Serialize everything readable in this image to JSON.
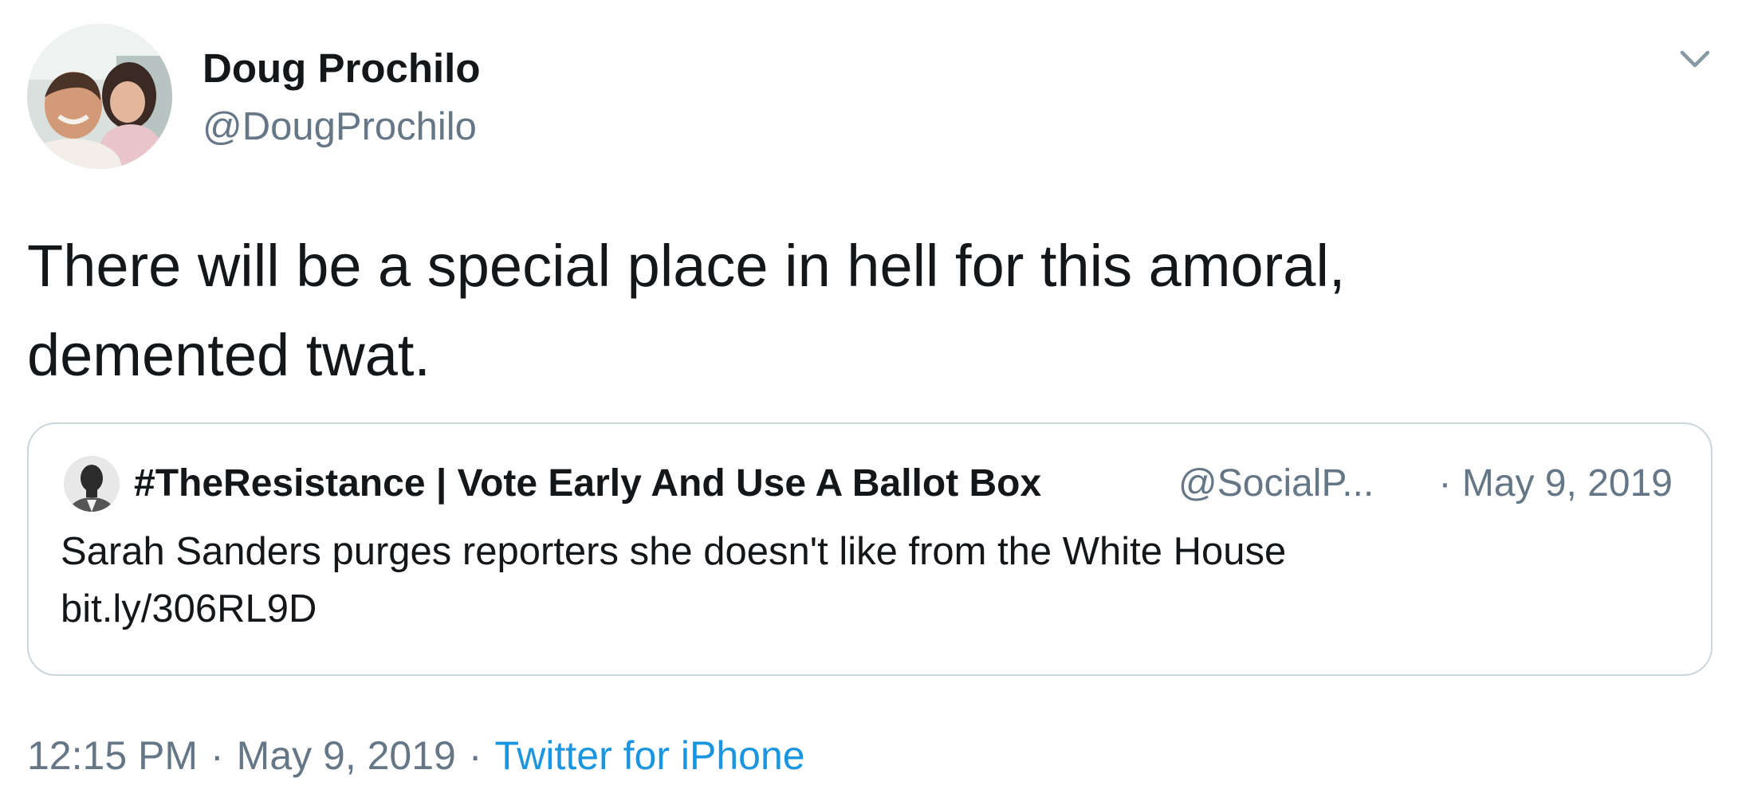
{
  "tweet": {
    "author": {
      "display_name": "Doug Prochilo",
      "handle": "@DougProchilo"
    },
    "text_lines": [
      "There will be a special place in hell for this amoral,",
      "demented twat."
    ],
    "quoted": {
      "display_name": "#TheResistance | Vote Early And Use A Ballot Box",
      "handle": "@SocialP...",
      "date": "· May 9, 2019",
      "text": "Sarah Sanders purges reporters she doesn't like from the White House",
      "link": "bit.ly/306RL9D"
    },
    "meta": {
      "time": "12:15 PM",
      "date": "May 9, 2019",
      "separator": "·",
      "source": "Twitter for iPhone"
    }
  },
  "icons": {
    "menu": "chevron-down-icon",
    "avatar": "profile-photo",
    "quote_avatar": "quoted-profile-photo"
  },
  "colors": {
    "text_primary": "#14171a",
    "text_secondary": "#657786",
    "link": "#1b95e0",
    "border": "#ccd6dd",
    "background": "#ffffff"
  }
}
